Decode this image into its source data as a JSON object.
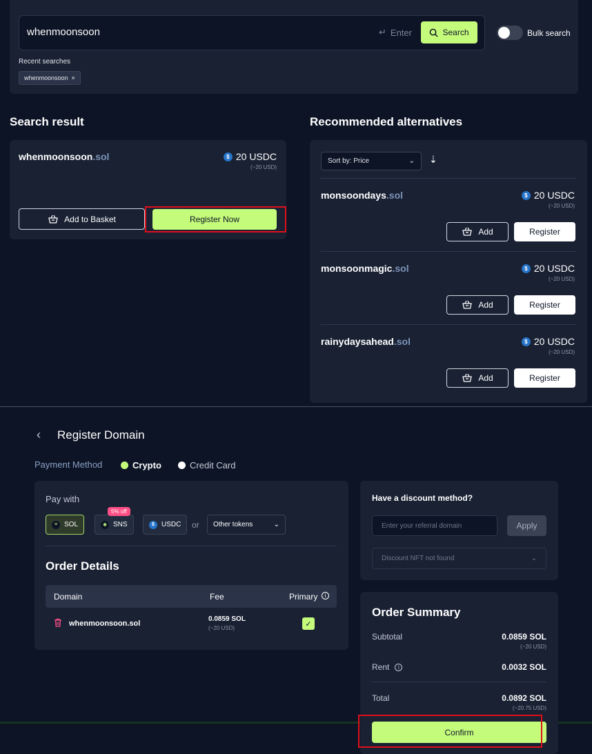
{
  "search": {
    "query": "whenmoonsoon",
    "enter_hint": "Enter",
    "search_label": "Search",
    "bulk_label": "Bulk search",
    "recent_label": "Recent searches",
    "recent_items": [
      "whenmoonsoon"
    ]
  },
  "result": {
    "title": "Search result",
    "name": "whenmoonsoon",
    "ext": ".sol",
    "price": "20 USDC",
    "price_sub": "(~20 USD)",
    "add_label": "Add to Basket",
    "register_label": "Register Now"
  },
  "alternatives": {
    "title": "Recommended alternatives",
    "sort_label": "Sort by: Price",
    "add_label": "Add",
    "register_label": "Register",
    "items": [
      {
        "name": "monsoondays",
        "ext": ".sol",
        "price": "20 USDC",
        "price_sub": "(~20 USD)"
      },
      {
        "name": "monsoonmagic",
        "ext": ".sol",
        "price": "20 USDC",
        "price_sub": "(~20 USD)"
      },
      {
        "name": "rainydaysahead",
        "ext": ".sol",
        "price": "20 USDC",
        "price_sub": "(~20 USD)"
      }
    ]
  },
  "register": {
    "title": "Register Domain",
    "payment_method_label": "Payment Method",
    "method_crypto": "Crypto",
    "method_card": "Credit Card",
    "pay_with_label": "Pay with",
    "tokens": [
      "SOL",
      "SNS",
      "USDC"
    ],
    "sns_badge": "5% off",
    "or_label": "or",
    "other_tokens": "Other tokens",
    "order_details_title": "Order Details",
    "col_domain": "Domain",
    "col_fee": "Fee",
    "col_primary": "Primary",
    "order_domain": "whenmoonsoon.sol",
    "order_fee": "0.0859 SOL",
    "order_fee_sub": "(~20 USD)"
  },
  "discount": {
    "title": "Have a discount method?",
    "placeholder": "Enter your referral domain",
    "apply_label": "Apply",
    "nft_placeholder": "Discount NFT not found"
  },
  "summary": {
    "title": "Order Summary",
    "subtotal_label": "Subtotal",
    "subtotal_val": "0.0859 SOL",
    "subtotal_sub": "(~20 USD)",
    "rent_label": "Rent",
    "rent_val": "0.0032 SOL",
    "total_label": "Total",
    "total_val": "0.0892 SOL",
    "total_sub": "(~20.75 USD)",
    "confirm_label": "Confirm"
  },
  "colors": {
    "accent": "#c4fb7b",
    "background": "#0d1426",
    "card": "#192133",
    "highlight": "#e0101a"
  }
}
